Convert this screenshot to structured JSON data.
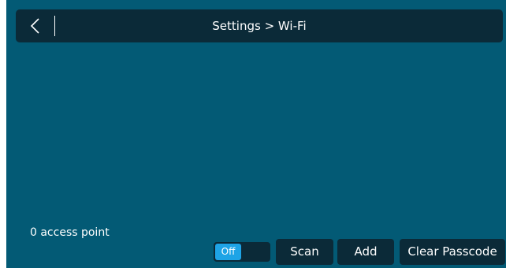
{
  "header": {
    "title": "Settings > Wi-Fi",
    "back_icon": "chevron-left-icon"
  },
  "status": {
    "access_point_count": "0 access point"
  },
  "controls": {
    "toggle_label": "Off",
    "scan_label": "Scan",
    "add_label": "Add",
    "clear_passcode_label": "Clear Passcode"
  },
  "colors": {
    "background": "#035a75",
    "bar": "#0b2a38",
    "toggle_accent": "#1ea4e6",
    "text": "#ffffff"
  }
}
